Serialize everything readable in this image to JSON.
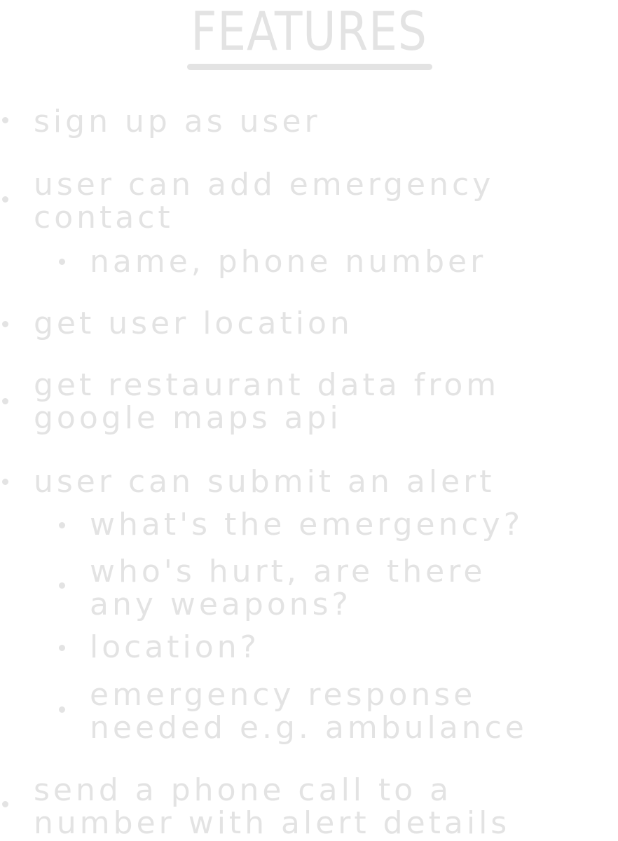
{
  "title": "FEATURES",
  "items": [
    {
      "text": [
        "sign up as user"
      ]
    },
    {
      "text": [
        "user can add emergency",
        "contact"
      ]
    },
    {
      "text": [
        "name, phone number"
      ]
    },
    {
      "text": [
        "get user location"
      ]
    },
    {
      "text": [
        "get restaurant data from",
        "google maps api"
      ]
    },
    {
      "text": [
        "user can submit an alert"
      ]
    },
    {
      "text": [
        "what's the emergency?"
      ]
    },
    {
      "text": [
        "who's hurt, are there",
        "any weapons?"
      ]
    },
    {
      "text": [
        "location?"
      ]
    },
    {
      "text": [
        "emergency response",
        "needed e.g. ambulance"
      ]
    },
    {
      "text": [
        "send a phone call to a",
        "number with alert details"
      ]
    }
  ]
}
